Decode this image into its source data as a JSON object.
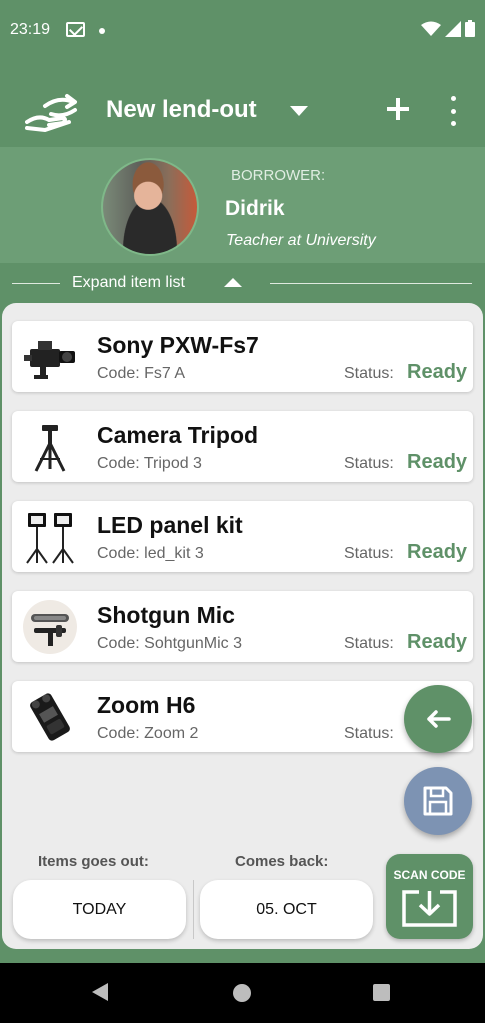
{
  "status_bar": {
    "time": "23:19"
  },
  "app_bar": {
    "title": "New lend-out"
  },
  "borrower": {
    "label": "BORROWER:",
    "name": "Didrik",
    "role": "Teacher at University"
  },
  "expand": {
    "label": "Expand item list"
  },
  "items": [
    {
      "name": "Sony PXW-Fs7",
      "code": "Code: Fs7 A",
      "status_label": "Status:",
      "status": "Ready",
      "icon": "camera-icon"
    },
    {
      "name": "Camera Tripod",
      "code": "Code: Tripod 3",
      "status_label": "Status:",
      "status": "Ready",
      "icon": "tripod-icon"
    },
    {
      "name": "LED panel kit",
      "code": "Code: led_kit 3",
      "status_label": "Status:",
      "status": "Ready",
      "icon": "led-panel-icon"
    },
    {
      "name": "Shotgun Mic",
      "code": "Code: SohtgunMic 3",
      "status_label": "Status:",
      "status": "Ready",
      "icon": "microphone-icon"
    },
    {
      "name": "Zoom H6",
      "code": "Code: Zoom 2",
      "status_label": "Status:",
      "status": "",
      "icon": "recorder-icon"
    }
  ],
  "dates": {
    "out_label": "Items goes out:",
    "out_value": "TODAY",
    "back_label": "Comes back:",
    "back_value": "05. OCT"
  },
  "scan": {
    "label": "SCAN CODE"
  },
  "colors": {
    "primary": "#5f9168",
    "panel": "#6d9e76",
    "ready": "#5f9168",
    "save_fab": "#7d93b3",
    "sheet": "#ececec"
  },
  "icons": {
    "app_logo": "lend-hand-icon",
    "add": "plus-icon",
    "more": "more-vert-icon",
    "back_fab": "arrow-left-icon",
    "save_fab": "save-icon",
    "scan": "download-tray-icon"
  }
}
